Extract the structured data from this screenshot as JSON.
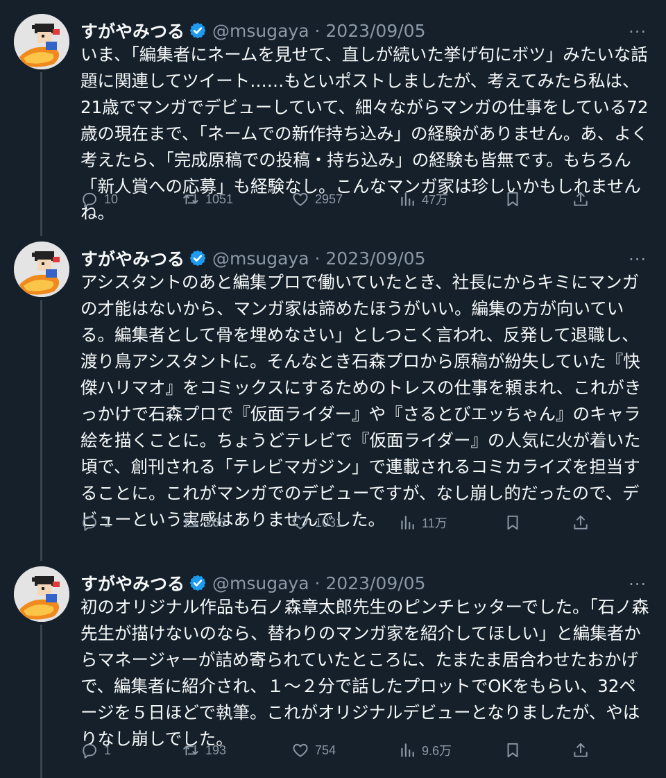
{
  "colors": {
    "background": "#15202b",
    "text": "#f7f9f9",
    "muted": "#8b98a5",
    "verified": "#1d9bf0",
    "thread_line": "#38444d"
  },
  "tweets": [
    {
      "name": "すがやみつる",
      "handle_date": "@msugaya · 2023/09/05",
      "more": "···",
      "text": "いま、「編集者にネームを見せて、直しが続いた挙げ句にボツ」みたいな話題に関連してツイート……もといポストしましたが、考えてみたら私は、21歳でマンガでデビューしていて、細々ながらマンガの仕事をしている72歳の現在まで、「ネームでの新作持ち込み」の経験がありません。あ、よく考えたら、「完成原稿での投稿・持ち込み」の経験も皆無です。もちろん「新人賞への応募」も経験なし。こんなマンガ家は珍しいかもしれませんね。",
      "replies": "10",
      "reposts": "1051",
      "likes": "2957",
      "views": "47万"
    },
    {
      "name": "すがやみつる",
      "handle_date": "@msugaya · 2023/09/05",
      "more": "···",
      "text": "アシスタントのあと編集プロで働いていたとき、社長にからキミにマンガの才能はないから、マンガ家は諦めたほうがいい。編集の方が向いている。編集者として骨を埋めなさい」としつこく言われ、反発して退職し、渡り鳥アシスタントに。そんなとき石森プロから原稿が紛失していた『快傑ハリマオ』をコミックスにするためのトレスの仕事を頼まれ、これがきっかけで石森プロで『仮面ライダー』や『さるとびエッちゃん』のキャラ絵を描くことに。ちょうどテレビで『仮面ライダー』の人気に火が着いた頃で、創刊される「テレビマガジン」で連載されるコミカライズを担当することに。これがマンガでのデビューですが、なし崩し的だったので、デビューという実感はありませんでした。",
      "replies": "1",
      "reposts": "263",
      "likes": "1031",
      "views": "11万"
    },
    {
      "name": "すがやみつる",
      "handle_date": "@msugaya · 2023/09/05",
      "more": "···",
      "text": "初のオリジナル作品も石ノ森章太郎先生のピンチヒッターでした。「石ノ森先生が描けないのなら、替わりのマンガ家を紹介してほしい」と編集者からマネージャーが詰め寄られていたところに、たまたま居合わせたおかげで、編集者に紹介され、１〜２分で話したプロットでOKをもらい、32ページを５日ほどで執筆。これがオリジナルデビューとなりましたが、やはりなし崩しでした。",
      "replies": "1",
      "reposts": "193",
      "likes": "754",
      "views": "9.6万"
    }
  ]
}
